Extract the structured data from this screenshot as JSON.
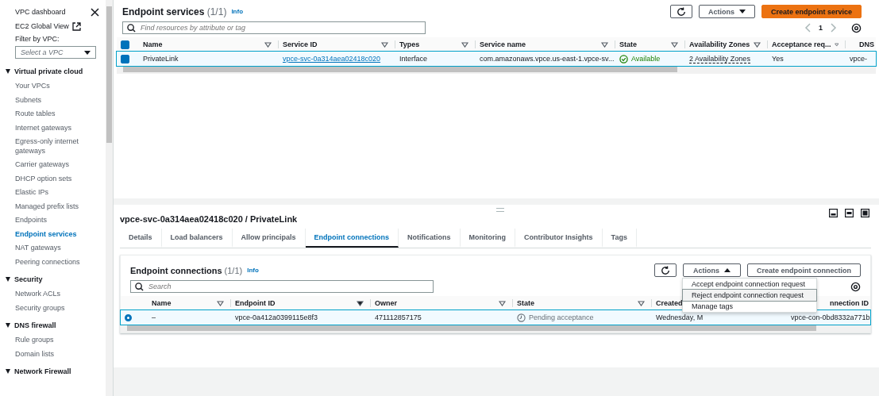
{
  "sidebar": {
    "top_links": [
      {
        "label": "VPC dashboard",
        "external": false
      },
      {
        "label": "EC2 Global View",
        "external": true
      }
    ],
    "filter": {
      "label": "Filter by VPC:",
      "placeholder": "Select a VPC"
    },
    "sections": [
      {
        "title": "Virtual private cloud",
        "expanded": true,
        "items": [
          {
            "label": "Your VPCs",
            "selected": false
          },
          {
            "label": "Subnets",
            "selected": false
          },
          {
            "label": "Route tables",
            "selected": false
          },
          {
            "label": "Internet gateways",
            "selected": false
          },
          {
            "label": "Egress-only internet gateways",
            "selected": false
          },
          {
            "label": "Carrier gateways",
            "selected": false
          },
          {
            "label": "DHCP option sets",
            "selected": false
          },
          {
            "label": "Elastic IPs",
            "selected": false
          },
          {
            "label": "Managed prefix lists",
            "selected": false
          },
          {
            "label": "Endpoints",
            "selected": false
          },
          {
            "label": "Endpoint services",
            "selected": true
          },
          {
            "label": "NAT gateways",
            "selected": false
          },
          {
            "label": "Peering connections",
            "selected": false
          }
        ]
      },
      {
        "title": "Security",
        "expanded": true,
        "items": [
          {
            "label": "Network ACLs",
            "selected": false
          },
          {
            "label": "Security groups",
            "selected": false
          }
        ]
      },
      {
        "title": "DNS firewall",
        "expanded": true,
        "items": [
          {
            "label": "Rule groups",
            "selected": false
          },
          {
            "label": "Domain lists",
            "selected": false
          }
        ]
      },
      {
        "title": "Network Firewall",
        "expanded": true
      }
    ]
  },
  "services": {
    "title": "Endpoint services",
    "count": "(1/1)",
    "info": "Info",
    "actions": "Actions",
    "create": "Create endpoint service",
    "search_placeholder": "Find resources by attribute or tag",
    "page": "1",
    "all_selected": true,
    "columns": [
      "Name",
      "Service ID",
      "Types",
      "Service name",
      "State",
      "Availability Zones",
      "Acceptance req...",
      "DNS"
    ],
    "rows": [
      {
        "selected": true,
        "name": "PrivateLink",
        "service_id": "vpce-svc-0a314aea02418c020",
        "type": "Interface",
        "service_name": "com.amazonaws.vpce.us-east-1.vpce-sv...",
        "state": "Available",
        "zones": "2 Availability Zones",
        "acceptance": "Yes",
        "dns": "vpce-"
      }
    ]
  },
  "detail": {
    "title": "vpce-svc-0a314aea02418c020 / PrivateLink",
    "tabs": [
      {
        "label": "Details",
        "selected": false
      },
      {
        "label": "Load balancers",
        "selected": false
      },
      {
        "label": "Allow principals",
        "selected": false
      },
      {
        "label": "Endpoint connections",
        "selected": true
      },
      {
        "label": "Notifications",
        "selected": false
      },
      {
        "label": "Monitoring",
        "selected": false
      },
      {
        "label": "Contributor Insights",
        "selected": false
      },
      {
        "label": "Tags",
        "selected": false
      }
    ],
    "connections": {
      "title": "Endpoint connections",
      "count": "(1/1)",
      "info": "Info",
      "actions": "Actions",
      "create": "Create endpoint connection",
      "search_placeholder": "Search",
      "menu": [
        {
          "label": "Accept endpoint connection request",
          "selected": false
        },
        {
          "label": "Reject endpoint connection request",
          "selected": true
        },
        {
          "label": "Manage tags",
          "selected": false
        }
      ],
      "columns": [
        "Name",
        "Endpoint ID",
        "Owner",
        "State",
        "Created",
        "nnection ID"
      ],
      "rows": [
        {
          "selected": true,
          "name": "–",
          "endpoint_id": "vpce-0a412a0399115e8f3",
          "owner": "471112857175",
          "state": "Pending acceptance",
          "created": "Wednesday, M",
          "connection_id": "vpce-con-0bd8332a771b"
        }
      ]
    }
  }
}
